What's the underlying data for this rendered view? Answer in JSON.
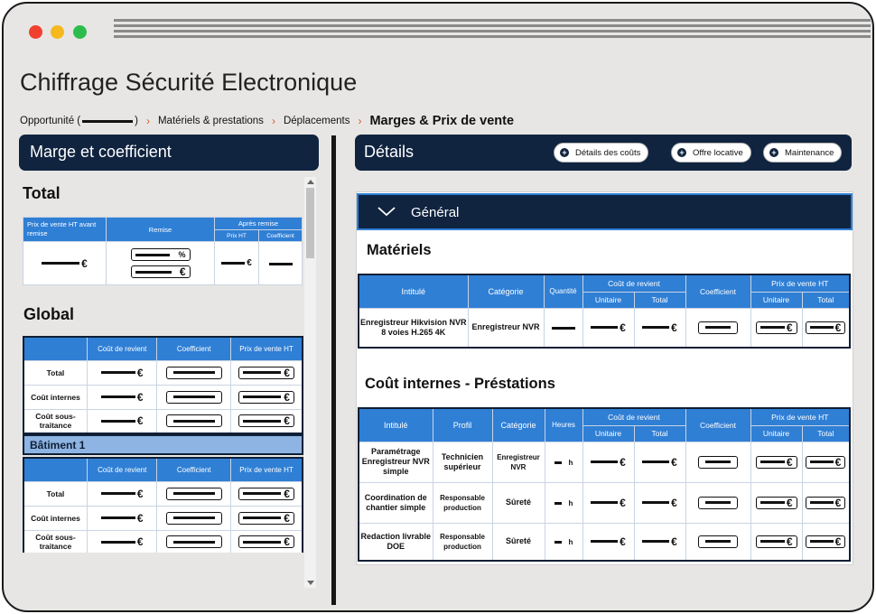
{
  "app_title": "Chiffrage Sécurité Electronique",
  "breadcrumb": {
    "items": [
      {
        "prefix": "Opportunité (",
        "suffix": ")"
      },
      {
        "label": "Matériels & prestations"
      },
      {
        "label": "Déplacements"
      },
      {
        "label": "Marges & Prix de vente"
      }
    ],
    "separator": "›"
  },
  "left_panel": {
    "title": "Marge et coefficient",
    "total": {
      "title": "Total",
      "headers": {
        "price_before_discount": "Prix de vente HT avant remise",
        "discount": "Remise",
        "after_discount": "Après remise",
        "price_ht": "Prix HT",
        "coefficient": "Coefficient"
      },
      "percent_symbol": "%",
      "euro_symbol": "€"
    },
    "global": {
      "title": "Global",
      "headers": {
        "cost": "Coût de revient",
        "coefficient": "Coefficient",
        "price_ht": "Prix de vente HT"
      },
      "rows": [
        "Total",
        "Coût internes",
        "Coût sous-traitance"
      ]
    },
    "building": {
      "title": "Bâtiment 1",
      "headers": {
        "cost": "Coût de revient",
        "coefficient": "Coefficient",
        "price_ht": "Prix de vente HT"
      },
      "rows": [
        "Total",
        "Coût internes",
        "Coût sous-traitance"
      ]
    }
  },
  "right_panel": {
    "title": "Détails",
    "buttons": [
      "Détails des coûts",
      "Offre locative",
      "Maintenance"
    ],
    "general_label": "Général",
    "materiels": {
      "title": "Matériels",
      "headers": {
        "intitule": "Intitulé",
        "categorie": "Catégorie",
        "quantite": "Quantité",
        "cout_revient": "Coût de revient",
        "unitaire": "Unitaire",
        "total": "Total",
        "coefficient": "Coefficient",
        "prix_vente": "Prix de vente HT"
      },
      "rows": [
        {
          "intitule": "Enregistreur Hikvision NVR 8 voies H.265 4K",
          "categorie": "Enregistreur NVR"
        }
      ]
    },
    "prestations": {
      "title": "Coût internes - Préstations",
      "headers": {
        "intitule": "Intitulé",
        "profil": "Profil",
        "categorie": "Catégorie",
        "heures": "Heures",
        "cout_revient": "Coût de revient",
        "unitaire": "Unitaire",
        "total": "Total",
        "coefficient": "Coefficient",
        "prix_vente": "Prix de vente HT"
      },
      "hour_unit": "h",
      "rows": [
        {
          "intitule": "Paramétrage Enregistreur NVR simple",
          "profil": "Technicien supérieur",
          "categorie": "Enregistreur NVR"
        },
        {
          "intitule": "Coordination de chantier simple",
          "profil": "Responsable production",
          "categorie": "Sûreté"
        },
        {
          "intitule": "Redaction livrable DOE",
          "profil": "Responsable production",
          "categorie": "Sûreté"
        }
      ]
    }
  },
  "colors": {
    "navy": "#102440",
    "blue": "#2f7fd5",
    "light_blue": "#8db4e2",
    "accent_orange": "#e2572b"
  },
  "icons": [
    "chevron-down-icon",
    "plus-circle-icon",
    "chevron-right-icon"
  ]
}
